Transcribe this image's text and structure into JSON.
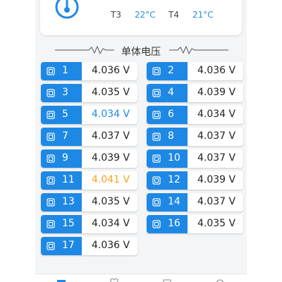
{
  "temps": [
    {
      "label": "T3",
      "value": "22°C"
    },
    {
      "label": "T4",
      "value": "21°C"
    }
  ],
  "section": {
    "title": "单体电压"
  },
  "colors": {
    "accent": "#1e88e5",
    "min": "#1e88e5",
    "max": "#f5a623"
  },
  "cells": [
    {
      "num": "1",
      "value": "4.036 V",
      "state": "normal"
    },
    {
      "num": "2",
      "value": "4.036 V",
      "state": "normal"
    },
    {
      "num": "3",
      "value": "4.035 V",
      "state": "normal"
    },
    {
      "num": "4",
      "value": "4.039 V",
      "state": "normal"
    },
    {
      "num": "5",
      "value": "4.034 V",
      "state": "min"
    },
    {
      "num": "6",
      "value": "4.034 V",
      "state": "normal"
    },
    {
      "num": "7",
      "value": "4.037 V",
      "state": "normal"
    },
    {
      "num": "8",
      "value": "4.037 V",
      "state": "normal"
    },
    {
      "num": "9",
      "value": "4.039 V",
      "state": "normal"
    },
    {
      "num": "10",
      "value": "4.037 V",
      "state": "normal"
    },
    {
      "num": "11",
      "value": "4.041 V",
      "state": "max"
    },
    {
      "num": "12",
      "value": "4.039 V",
      "state": "normal"
    },
    {
      "num": "13",
      "value": "4.035 V",
      "state": "normal"
    },
    {
      "num": "14",
      "value": "4.037 V",
      "state": "normal"
    },
    {
      "num": "15",
      "value": "4.034 V",
      "state": "normal"
    },
    {
      "num": "16",
      "value": "4.035 V",
      "state": "normal"
    },
    {
      "num": "17",
      "value": "4.036 V",
      "state": "normal"
    }
  ],
  "nav": {
    "icons": [
      "home-icon",
      "heart-icon",
      "device-icon",
      "profile-icon"
    ]
  }
}
